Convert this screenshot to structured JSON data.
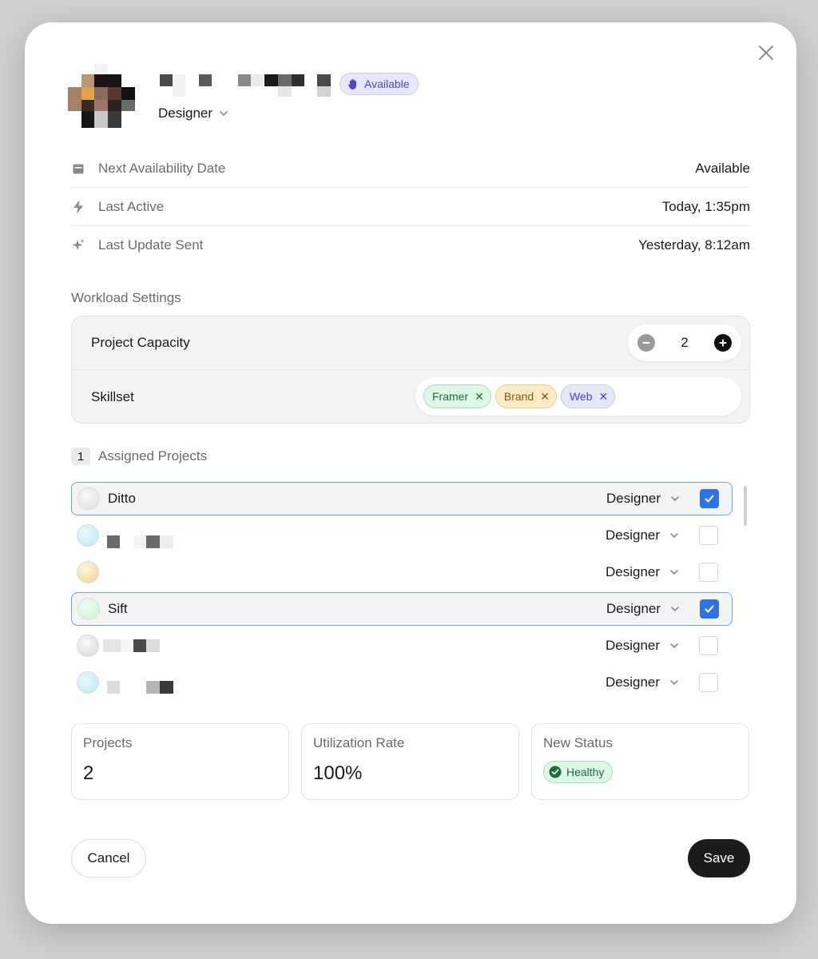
{
  "profile": {
    "status_badge": "Available",
    "role": "Designer"
  },
  "info_rows": [
    {
      "label": "Next Availability Date",
      "value": "Available",
      "icon": "calendar-icon"
    },
    {
      "label": "Last Active",
      "value": "Today, 1:35pm",
      "icon": "lightning-icon"
    },
    {
      "label": "Last Update Sent",
      "value": "Yesterday, 8:12am",
      "icon": "sparkle-icon"
    }
  ],
  "workload": {
    "title": "Workload Settings",
    "capacity_label": "Project Capacity",
    "capacity_value": "2",
    "skillset_label": "Skillset",
    "skills": [
      "Framer",
      "Brand",
      "Web"
    ]
  },
  "assigned": {
    "count": "1",
    "title": "Assigned Projects",
    "projects": [
      {
        "name": "Ditto",
        "role": "Designer",
        "checked": true
      },
      {
        "name": "",
        "role": "Designer",
        "checked": false
      },
      {
        "name": "",
        "role": "Designer",
        "checked": false
      },
      {
        "name": "Sift",
        "role": "Designer",
        "checked": true
      },
      {
        "name": "",
        "role": "Designer",
        "checked": false
      },
      {
        "name": "",
        "role": "Designer",
        "checked": false
      }
    ]
  },
  "stats": {
    "projects_label": "Projects",
    "projects_value": "2",
    "utilization_label": "Utilization Rate",
    "utilization_value": "100%",
    "status_label": "New Status",
    "status_value": "Healthy"
  },
  "actions": {
    "cancel": "Cancel",
    "save": "Save"
  },
  "colors": {
    "accent_blue": "#2f74e3",
    "available_purple": "#4c45d6",
    "healthy_green": "#1f6b3b"
  }
}
